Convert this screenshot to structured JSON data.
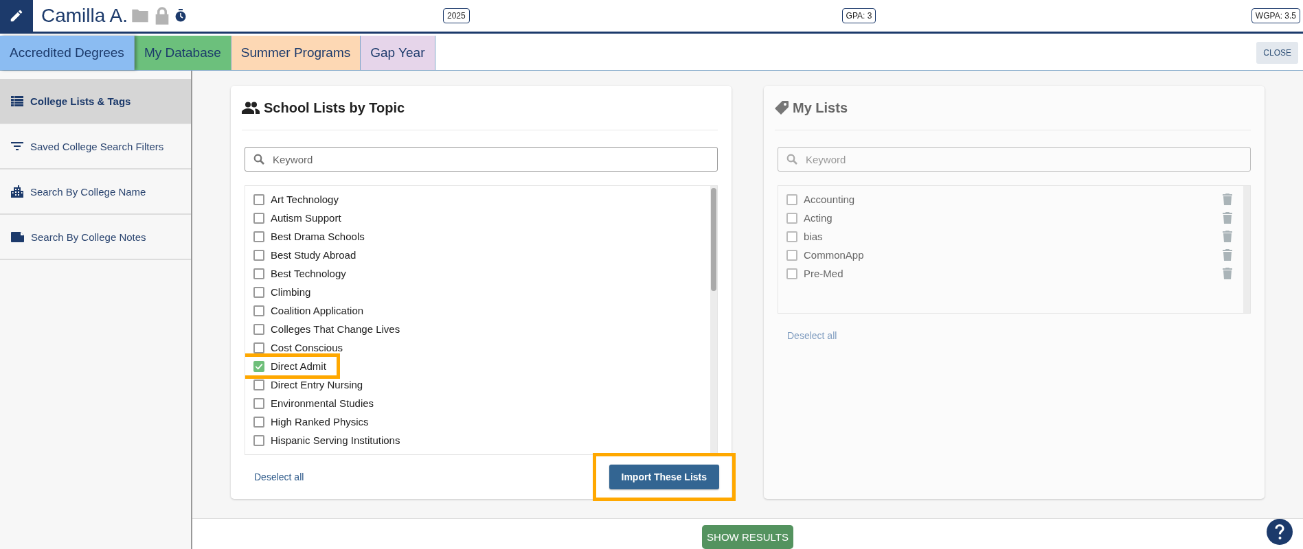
{
  "header": {
    "student_name": "Camilla A.",
    "badges": [
      "2025",
      "GPA: 3",
      "WGPA: 3.5"
    ]
  },
  "tabs": [
    {
      "label": "Accredited Degrees",
      "selected": true,
      "color": "#8bbcf2"
    },
    {
      "label": "My Database",
      "selected": false,
      "color": "#6cc07c"
    },
    {
      "label": "Summer Programs",
      "selected": false,
      "color": "#fdd8b4"
    },
    {
      "label": "Gap Year",
      "selected": false,
      "color": "#e6d5ea"
    }
  ],
  "close_button": "CLOSE",
  "sidebar": {
    "items": [
      {
        "label": "College Lists & Tags",
        "selected": true,
        "kind": "list"
      },
      {
        "label": "Saved College Search Filters",
        "selected": false,
        "kind": "filter"
      },
      {
        "label": "Search By College Name",
        "selected": false,
        "kind": "building"
      },
      {
        "label": "Search By College Notes",
        "selected": false,
        "kind": "note"
      }
    ]
  },
  "school_lists": {
    "title": "School Lists by Topic",
    "disabled": false,
    "deletable": false,
    "search": {
      "placeholder": "Keyword"
    },
    "items": [
      {
        "label": "Art Technology",
        "checked": false,
        "highlighted": false
      },
      {
        "label": "Autism Support",
        "checked": false,
        "highlighted": false
      },
      {
        "label": "Best Drama Schools",
        "checked": false,
        "highlighted": false
      },
      {
        "label": "Best Study Abroad",
        "checked": false,
        "highlighted": false
      },
      {
        "label": "Best Technology",
        "checked": false,
        "highlighted": false
      },
      {
        "label": "Climbing",
        "checked": false,
        "highlighted": false
      },
      {
        "label": "Coalition Application",
        "checked": false,
        "highlighted": false
      },
      {
        "label": "Colleges That Change Lives",
        "checked": false,
        "highlighted": false
      },
      {
        "label": "Cost Conscious",
        "checked": false,
        "highlighted": false
      },
      {
        "label": "Direct Admit",
        "checked": true,
        "highlighted": true
      },
      {
        "label": "Direct Entry Nursing",
        "checked": false,
        "highlighted": false
      },
      {
        "label": "Environmental Studies",
        "checked": false,
        "highlighted": false
      },
      {
        "label": "High Ranked Physics",
        "checked": false,
        "highlighted": false
      },
      {
        "label": "Hispanic Serving Institutions",
        "checked": false,
        "highlighted": false
      }
    ],
    "deselect_all": "Deselect all",
    "import_button": {
      "label": "Import These Lists",
      "highlighted": true
    }
  },
  "my_lists": {
    "title": "My Lists",
    "disabled": true,
    "deletable": true,
    "search": {
      "placeholder": "Keyword"
    },
    "items": [
      {
        "label": "Accounting",
        "checked": false,
        "highlighted": false
      },
      {
        "label": "Acting",
        "checked": false,
        "highlighted": false
      },
      {
        "label": "bias",
        "checked": false,
        "highlighted": false
      },
      {
        "label": "CommonApp",
        "checked": false,
        "highlighted": false
      },
      {
        "label": "Pre-Med",
        "checked": false,
        "highlighted": false
      }
    ],
    "deselect_all": "Deselect all"
  },
  "show_results_button": "SHOW RESULTS"
}
